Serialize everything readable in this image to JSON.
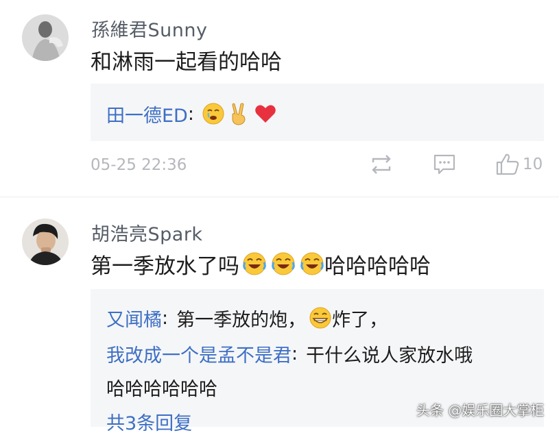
{
  "comments": [
    {
      "username": "孫維君Sunny",
      "content": "和淋雨一起看的哈哈",
      "replies": [
        {
          "name": "田一德ED",
          "separator": ":"
        }
      ],
      "timestamp": "05-25 22:36",
      "like_count": "10"
    },
    {
      "username": "胡浩亮Spark",
      "content_text": "第一季放水了吗",
      "content_suffix": "哈哈哈哈哈",
      "replies": [
        {
          "name": "又闻橘",
          "separator": ":",
          "text_before": "第一季放的炮，",
          "text_after": "炸了，"
        },
        {
          "name": "我改成一个是孟不是君",
          "separator": ":",
          "text": "干什么说人家放水哦",
          "text_cont": "哈哈哈哈哈哈"
        }
      ],
      "more_replies": "共3条回复"
    }
  ],
  "watermark": "头条 @娱乐圈大掌柜",
  "colors": {
    "link": "#3d6fc4",
    "meta": "#b4b7bc",
    "reply_bg": "#f5f6f8",
    "heart": "#e8313f"
  },
  "icons": [
    "repost-icon",
    "comment-icon",
    "thumbs-up-icon",
    "tearful-emoji",
    "victory-hand-emoji",
    "heart-emoji",
    "laughing-tears-emoji",
    "grinning-emoji"
  ]
}
